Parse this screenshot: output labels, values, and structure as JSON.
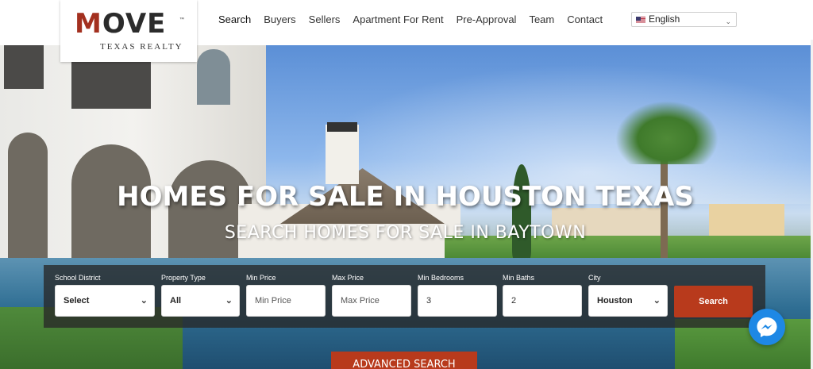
{
  "logo": {
    "word": "MOVE",
    "first_letter": "M",
    "rest": "OVE",
    "tm": "™",
    "tagline": "TEXAS REALTY",
    "colors": {
      "accent": "#a3301f",
      "text": "#2b2b2b"
    }
  },
  "nav": {
    "items": [
      {
        "label": "Search",
        "active": true
      },
      {
        "label": "Buyers"
      },
      {
        "label": "Sellers"
      },
      {
        "label": "Apartment For Rent"
      },
      {
        "label": "Pre-Approval"
      },
      {
        "label": "Team"
      },
      {
        "label": "Contact"
      }
    ]
  },
  "language": {
    "selected": "English",
    "flag_icon": "us-flag-icon",
    "caret": "⌄"
  },
  "hero": {
    "title": "HOMES FOR SALE IN HOUSTON TEXAS",
    "subtitle": "SEARCH HOMES FOR SALE IN BAYTOWN"
  },
  "search": {
    "fields": [
      {
        "label": "School District",
        "value": "Select",
        "type": "select"
      },
      {
        "label": "Property Type",
        "value": "All",
        "type": "select"
      },
      {
        "label": "Min Price",
        "placeholder": "Min Price",
        "type": "input"
      },
      {
        "label": "Max Price",
        "placeholder": "Max Price",
        "type": "input"
      },
      {
        "label": "Min Bedrooms",
        "value": "3",
        "type": "input"
      },
      {
        "label": "Min Baths",
        "value": "2",
        "type": "input"
      },
      {
        "label": "City",
        "value": "Houston",
        "type": "select"
      }
    ],
    "search_button": "Search",
    "advanced_button": "ADVANCED SEARCH",
    "colors": {
      "button": "#b83a1c",
      "panel": "#282828"
    }
  },
  "chat": {
    "icon": "messenger-icon"
  }
}
